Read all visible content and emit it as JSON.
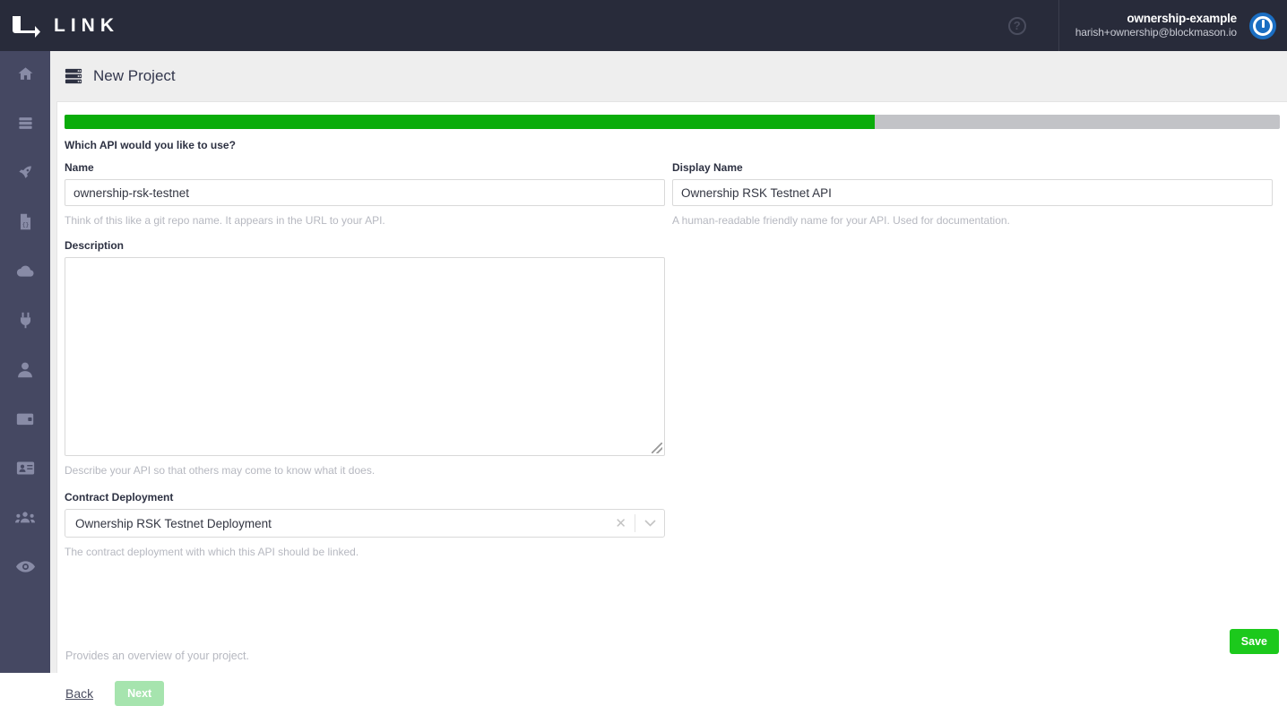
{
  "brand": {
    "name": "LINK",
    "logo_icon": "link-bracket-logo"
  },
  "topbar": {
    "help_icon": "question-mark-icon",
    "user_name": "ownership-example",
    "user_email": "harish+ownership@blockmason.io",
    "power_icon": "power-logout-icon",
    "background_color": "#282b3a"
  },
  "sidebar": {
    "background_color": "#454862",
    "items": [
      {
        "icon": "home-icon",
        "label": "Home"
      },
      {
        "icon": "stack-layers-icon",
        "label": "Projects"
      },
      {
        "icon": "rocket-icon",
        "label": "Deployments"
      },
      {
        "icon": "file-code-icon",
        "label": "Contracts"
      },
      {
        "icon": "cloud-icon",
        "label": "Cloud"
      },
      {
        "icon": "plug-icon",
        "label": "Integrations"
      },
      {
        "icon": "user-icon",
        "label": "Account"
      },
      {
        "icon": "wallet-icon",
        "label": "Wallet"
      },
      {
        "icon": "id-card-icon",
        "label": "Identity"
      },
      {
        "icon": "users-group-icon",
        "label": "Team"
      },
      {
        "icon": "eye-icon",
        "label": "Monitor"
      }
    ]
  },
  "page": {
    "title": "New Project",
    "title_icon": "server-rack-icon"
  },
  "progress": {
    "percent": 66.7,
    "fill_color": "#0aac0a",
    "track_color": "#c2c3c7"
  },
  "form": {
    "question": "Which API would you like to use?",
    "name": {
      "label": "Name",
      "value": "ownership-rsk-testnet",
      "placeholder": "",
      "helper": "Think of this like a git repo name. It appears in the URL to your API."
    },
    "display_name": {
      "label": "Display Name",
      "value": "Ownership RSK Testnet API",
      "placeholder": "",
      "helper": "A human-readable friendly name for your API. Used for documentation."
    },
    "description": {
      "label": "Description",
      "value": "",
      "placeholder": "",
      "helper": "Describe your API so that others may come to know what it does.",
      "resize_handle_icon": "resize-grip-icon"
    },
    "contract_deployment": {
      "label": "Contract Deployment",
      "value": "Ownership RSK Testnet Deployment",
      "helper": "The contract deployment with which this API should be linked.",
      "clear_icon": "close-x-icon",
      "dropdown_icon": "chevron-down-icon"
    }
  },
  "actions": {
    "save_label": "Save",
    "save_color": "#1cc91c",
    "overview_note": "Provides an overview of your project.",
    "back_label": "Back",
    "next_label": "Next",
    "next_color": "#a6e4ae"
  }
}
